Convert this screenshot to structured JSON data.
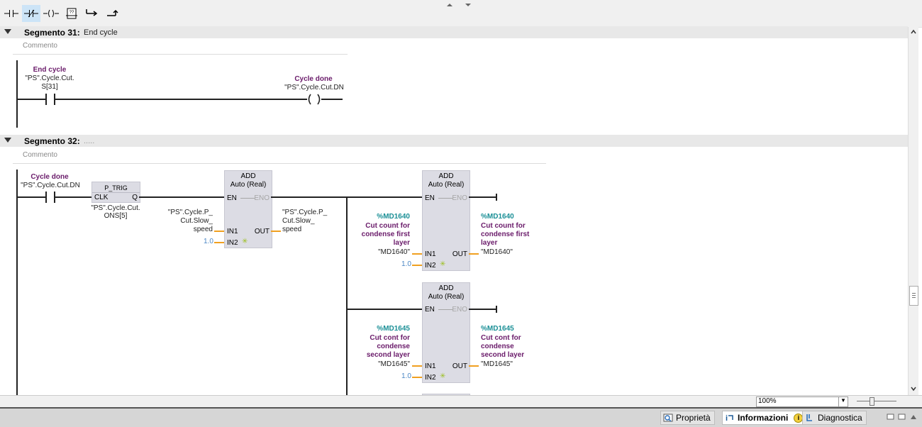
{
  "toolbar": {
    "buttons": [
      {
        "name": "Normally open contact",
        "icon": "no-contact-icon"
      },
      {
        "name": "Normally closed contact",
        "icon": "nc-contact-icon"
      },
      {
        "name": "Coil",
        "icon": "coil-icon"
      },
      {
        "name": "Empty box",
        "icon": "empty-box-icon"
      },
      {
        "name": "Open branch",
        "icon": "open-branch-icon"
      },
      {
        "name": "Close branch",
        "icon": "close-branch-icon"
      }
    ]
  },
  "segment31": {
    "title": "Segmento 31:",
    "name": "End cycle",
    "comment": "Commento",
    "contact": {
      "symbol": "End cycle",
      "operand_line1": "\"PS\".Cycle.Cut.",
      "operand_line2": "S[31]"
    },
    "coil": {
      "symbol": "Cycle done",
      "operand": "\"PS\".Cycle.Cut.DN"
    }
  },
  "segment32": {
    "title": "Segmento 32:",
    "name": ".....",
    "comment": "Commento",
    "contact": {
      "symbol": "Cycle done",
      "operand": "\"PS\".Cycle.Cut.DN"
    },
    "ptrig": {
      "title": "P_TRIG",
      "clk": "CLK",
      "q": "Q",
      "operand_line1": "\"PS\".Cycle.Cut.",
      "operand_line2": "ONS[5]"
    },
    "add1": {
      "title": "ADD",
      "type": "Auto (Real)",
      "en": "EN",
      "eno": "ENO",
      "in1": "IN1",
      "in2": "IN2",
      "out": "OUT",
      "in1_operand": [
        "\"PS\".Cycle.P_",
        "Cut.Slow_",
        "speed"
      ],
      "in2_value": "1.0",
      "out_operand": [
        "\"PS\".Cycle.P_",
        "Cut.Slow_",
        "speed"
      ]
    },
    "add2": {
      "title": "ADD",
      "type": "Auto (Real)",
      "en": "EN",
      "eno": "ENO",
      "in1": "IN1",
      "in2": "IN2",
      "out": "OUT",
      "in1_address": "%MD1640",
      "in1_comment": [
        "Cut count for",
        "condense first",
        "layer"
      ],
      "in1_operand": "\"MD1640\"",
      "in2_value": "1.0",
      "out_address": "%MD1640",
      "out_comment": [
        "Cut count for",
        "condense first",
        "layer"
      ],
      "out_operand": "\"MD1640\""
    },
    "add3": {
      "title": "ADD",
      "type": "Auto (Real)",
      "en": "EN",
      "eno": "ENO",
      "in1": "IN1",
      "in2": "IN2",
      "out": "OUT",
      "in1_address": "%MD1645",
      "in1_comment": [
        "Cut cont for",
        "condense",
        "second layer"
      ],
      "in1_operand": "\"MD1645\"",
      "in2_value": "1.0",
      "out_address": "%MD1645",
      "out_comment": [
        "Cut cont for",
        "condense",
        "second layer"
      ],
      "out_operand": "\"MD1645\""
    }
  },
  "zoom": {
    "value": "100%"
  },
  "status": {
    "tabs": [
      {
        "label": "Proprietà",
        "icon": "properties-icon"
      },
      {
        "label": "Informazioni",
        "icon": "info-icon"
      },
      {
        "label": "Diagnostica",
        "icon": "diagnostics-icon"
      }
    ]
  },
  "colors": {
    "symbol": "#6a1b6a",
    "address": "#1a8f96",
    "constant": "#4a86c5",
    "box": "#dcdce4",
    "pin_wire": "#f0a020"
  }
}
